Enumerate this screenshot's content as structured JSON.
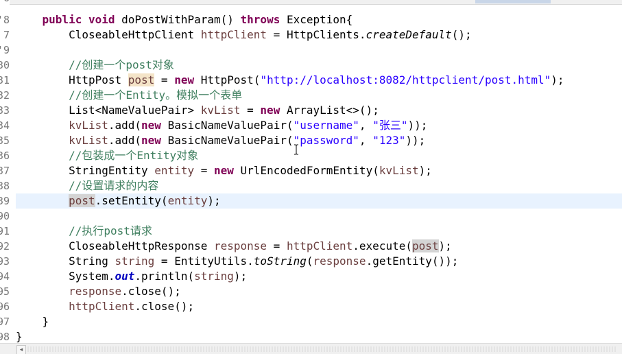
{
  "editor": {
    "line_numbers": [
      "6",
      "78",
      "79",
      "80",
      "81",
      "82",
      "83",
      "84",
      "85",
      "86",
      "87",
      "88",
      "89",
      "90",
      "91",
      "92",
      "93",
      "94",
      "95",
      "96",
      "97",
      "98"
    ],
    "gutter_digits": [
      "6",
      "7",
      "'8",
      "'9",
      "30",
      "31",
      "32",
      "33",
      "34",
      "35",
      "36",
      "37",
      "38",
      "39",
      "90",
      "91",
      "92",
      "93",
      "94",
      "95",
      "96",
      "97",
      "98"
    ],
    "current_line_index": 13,
    "code": {
      "l1": {
        "kw1": "public",
        "kw2": "void",
        "rest1": " doPostWithParam() ",
        "kw3": "throws",
        "rest2": " Exception{"
      },
      "l2": {
        "t1": "CloseableHttpClient ",
        "v1": "httpClient",
        "t2": " = HttpClients.",
        "m1": "createDefault",
        "t3": "();"
      },
      "l3": {},
      "l4": {
        "c": "//创建一个post对象"
      },
      "l5": {
        "t1": "HttpPost ",
        "v1": "post",
        "t2": " = ",
        "kw": "new",
        "t3": " HttpPost(",
        "s": "\"http://localhost:8082/httpclient/post.html\"",
        "t4": ");"
      },
      "l6": {
        "c": "//创建一个Entity。模拟一个表单"
      },
      "l7": {
        "t1": "List<NameValuePair> ",
        "v1": "kvList",
        "t2": " = ",
        "kw": "new",
        "t3": " ArrayList<>();"
      },
      "l8": {
        "v1": "kvList",
        "t1": ".add(",
        "kw": "new",
        "t2": " BasicNameValuePair(",
        "s1": "\"username\"",
        "t3": ", ",
        "s2": "\"张三\"",
        "t4": "));"
      },
      "l9": {
        "v1": "kvList",
        "t1": ".add(",
        "kw": "new",
        "t2": " BasicNameValuePair(",
        "s1": "\"password\"",
        "t3": ", ",
        "s2": "\"123\"",
        "t4": "));"
      },
      "l10": {
        "c": "//包装成一个Entity对象"
      },
      "l11": {
        "t1": "StringEntity ",
        "v1": "entity",
        "t2": " = ",
        "kw": "new",
        "t3": " UrlEncodedFormEntity(",
        "v2": "kvList",
        "t4": ");"
      },
      "l12": {
        "c": "//设置请求的内容"
      },
      "l13": {
        "v1": "post",
        "t1": ".setEntity(",
        "v2": "entity",
        "t2": ");"
      },
      "l14": {},
      "l15": {
        "c": "//执行post请求"
      },
      "l16": {
        "t1": "CloseableHttpResponse ",
        "v1": "response",
        "t2": " = ",
        "v2": "httpClient",
        "t3": ".execute(",
        "v3": "post",
        "t4": ");"
      },
      "l17": {
        "t1": "String ",
        "v1": "string",
        "t2": " = EntityUtils.",
        "m1": "toString",
        "t3": "(",
        "v2": "response",
        "t4": ".getEntity());"
      },
      "l18": {
        "t1": "System.",
        "f1": "out",
        "t2": ".println(",
        "v1": "string",
        "t3": ");"
      },
      "l19": {
        "v1": "response",
        "t1": ".close();"
      },
      "l20": {
        "v1": "httpClient",
        "t1": ".close();"
      },
      "l21": {
        "t1": "}"
      },
      "l22": {
        "t1": "}"
      }
    },
    "scrollbar": {
      "left_arrow": "◂"
    }
  },
  "colors": {
    "keyword": "#7f0055",
    "local_variable": "#6a3e3e",
    "string": "#2a00ff",
    "comment": "#3f7f5f",
    "static_field": "#0000c0",
    "current_line": "#e8f2fe",
    "occurrence": "#d4d4d4"
  }
}
